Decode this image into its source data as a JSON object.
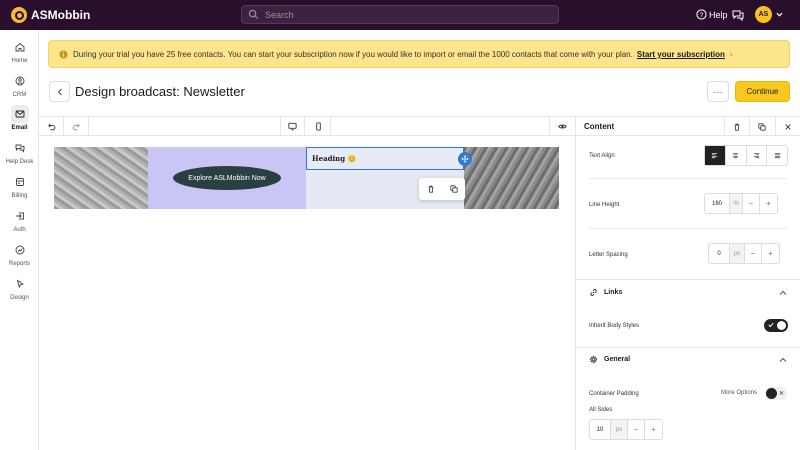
{
  "app": {
    "name": "ASMobbin"
  },
  "search": {
    "placeholder": "Search"
  },
  "header": {
    "help_label": "Help",
    "avatar_initials": "AS"
  },
  "sidebar": {
    "items": [
      {
        "label": "Home",
        "icon": "home-icon"
      },
      {
        "label": "CRM",
        "icon": "crm-icon"
      },
      {
        "label": "Email",
        "icon": "email-icon",
        "active": true
      },
      {
        "label": "Help Desk",
        "icon": "helpdesk-icon"
      },
      {
        "label": "Billing",
        "icon": "billing-icon"
      },
      {
        "label": "Auth",
        "icon": "auth-icon"
      },
      {
        "label": "Reports",
        "icon": "reports-icon"
      },
      {
        "label": "Design",
        "icon": "design-icon"
      }
    ]
  },
  "banner": {
    "text": "During your trial you have 25 free contacts. You can start your subscription now if you would like to import or email the 1000 contacts that come with your plan.",
    "link": "Start your subscription"
  },
  "page": {
    "title": "Design broadcast: Newsletter",
    "continue_label": "Continue",
    "more_label": "···"
  },
  "canvas": {
    "cta_label": "Explore ASLMobbin Now",
    "heading_text": "Heading 😊"
  },
  "panel": {
    "title": "Content",
    "text_align_label": "Text Align",
    "line_height_label": "Line Height",
    "line_height_value": "160",
    "line_height_unit": "%",
    "letter_spacing_label": "Letter Spacing",
    "letter_spacing_value": "0",
    "letter_spacing_unit": "px",
    "links_title": "Links",
    "inherit_label": "Inherit Body Styles",
    "general_title": "General",
    "container_padding_label": "Container Padding",
    "more_options_label": "More Options",
    "all_sides_label": "All Sides",
    "padding_value": "10",
    "padding_unit": "px",
    "minus": "−",
    "plus": "+"
  },
  "colors": {
    "topbar": "#2a0f2d",
    "accent": "#f8c81c",
    "banner": "#fde58b",
    "selection": "#2f7bd3"
  }
}
